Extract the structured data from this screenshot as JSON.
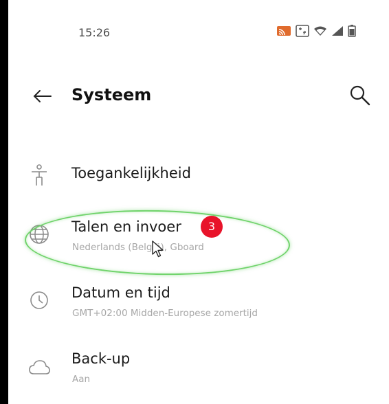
{
  "status_bar": {
    "time": "15:26",
    "icons": [
      "cast-icon",
      "screenshot-icon",
      "wifi-icon",
      "signal-icon",
      "battery-icon"
    ]
  },
  "header": {
    "back_icon": "arrow-left-icon",
    "title": "Systeem",
    "search_icon": "search-icon"
  },
  "items": [
    {
      "title": "Toegankelijkheid",
      "subtitle": "",
      "icon": "accessibility-icon"
    },
    {
      "title": "Talen en invoer",
      "subtitle": "Nederlands (België), Gboard",
      "icon": "globe-icon"
    },
    {
      "title": "Datum en tijd",
      "subtitle": "GMT+02:00 Midden-Europese zomertijd",
      "icon": "clock-icon"
    },
    {
      "title": "Back-up",
      "subtitle": "Aan",
      "icon": "cloud-icon"
    }
  ],
  "annotation": {
    "badge_number": "3",
    "highlight_color": "#6fd36a",
    "badge_color": "#e8132a"
  }
}
